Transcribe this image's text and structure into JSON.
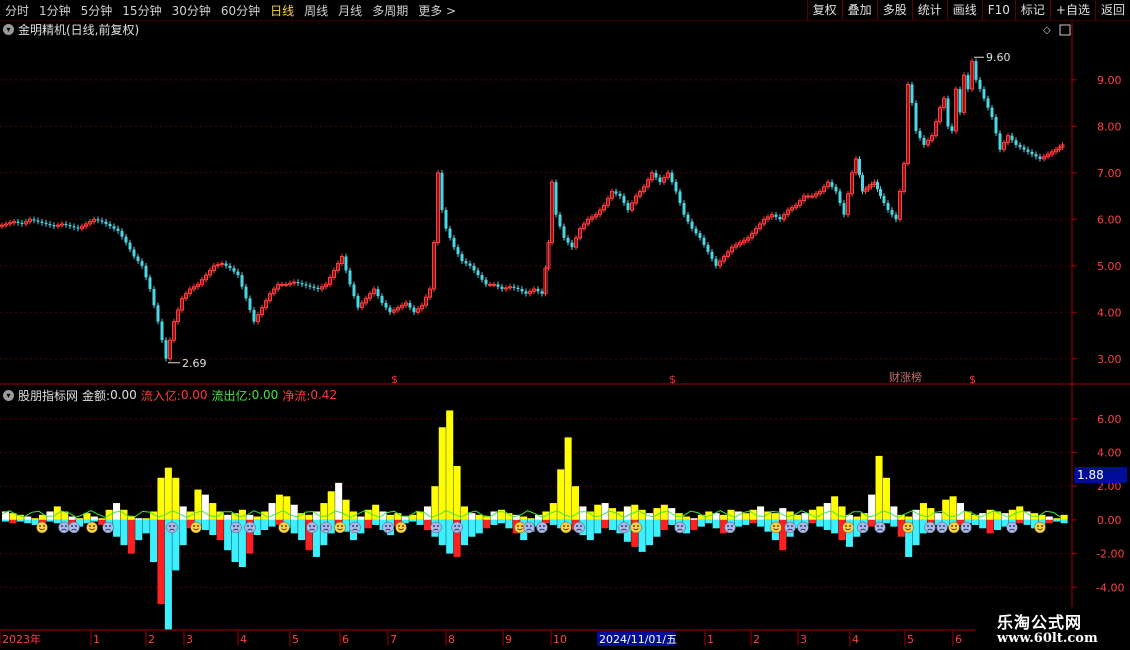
{
  "toolbar": {
    "periods": [
      "分时",
      "1分钟",
      "5分钟",
      "15分钟",
      "30分钟",
      "60分钟",
      "日线",
      "周线",
      "月线",
      "多周期",
      "更多 >"
    ],
    "active_period": "日线",
    "actions": [
      "复权",
      "叠加",
      "多股",
      "统计",
      "画线",
      "F10",
      "标记",
      "+自选",
      "返回"
    ]
  },
  "main_title": "金明精机(日线,前复权)",
  "indicator_header": {
    "name": "股朋指标网",
    "amount_label": "金额:",
    "amount_value": "0.00",
    "inflow_label": "流入亿:",
    "inflow_value": "0.00",
    "outflow_label": "流出亿:",
    "outflow_value": "0.00",
    "net_label": "净流:",
    "net_value": "0.42"
  },
  "markers": {
    "high_label": "9.60",
    "low_label": "2.69",
    "event_label": "财涨榜",
    "dollar": "$"
  },
  "current_value_badge": "1.88",
  "watermark": {
    "title": "乐淘公式网",
    "url": "www.60lt.com"
  },
  "time_axis": {
    "labels": [
      "2023年",
      "1",
      "2",
      "3",
      "4",
      "5",
      "6",
      "7",
      "8",
      "9",
      "10",
      "2024/11/01/五",
      "1",
      "2",
      "3",
      "4",
      "5",
      "6"
    ],
    "positions": [
      2,
      93,
      148,
      186,
      240,
      292,
      342,
      390,
      448,
      505,
      553,
      598,
      707,
      753,
      800,
      852,
      907,
      955
    ]
  },
  "colors": {
    "up": "#ff3b3b",
    "down": "#4ad7e6",
    "yellow": "#ffff00",
    "white": "#ffffff",
    "cyan": "#3cf0ff",
    "red": "#ff2020",
    "green": "#3fe83f",
    "grid": "#5a0000"
  },
  "chart_data": [
    {
      "type": "line",
      "title": "金明精机(日线,前复权)",
      "ylim": [
        2.5,
        9.9
      ],
      "yticks": [
        "3.00",
        "4.00",
        "5.00",
        "6.00",
        "7.00",
        "8.00",
        "9.00"
      ],
      "grid": true,
      "x": [
        0,
        8,
        16,
        24,
        32,
        40,
        48,
        56,
        64,
        72,
        80,
        88,
        96,
        104,
        112,
        120,
        128,
        136,
        144,
        152,
        160,
        168,
        176,
        184,
        192,
        200,
        208,
        216,
        224,
        232,
        240,
        248,
        256,
        264,
        272,
        280,
        288,
        296,
        304,
        312,
        320,
        328,
        336,
        344,
        352,
        360,
        368,
        376,
        384,
        392,
        400,
        408,
        416,
        424,
        432,
        436,
        440,
        444,
        448,
        456,
        464,
        472,
        480,
        488,
        496,
        504,
        512,
        520,
        528,
        536,
        544,
        550,
        554,
        558,
        566,
        574,
        582,
        590,
        598,
        606,
        614,
        622,
        630,
        638,
        646,
        654,
        662,
        670,
        678,
        686,
        694,
        702,
        710,
        718,
        726,
        734,
        742,
        750,
        758,
        766,
        774,
        782,
        790,
        798,
        806,
        814,
        822,
        830,
        838,
        846,
        854,
        858,
        864,
        870,
        876,
        882,
        890,
        898,
        906,
        910,
        914,
        918,
        926,
        934,
        942,
        946,
        950,
        954,
        958,
        962,
        966,
        970,
        974,
        978,
        986,
        994,
        1002,
        1010,
        1018,
        1026,
        1034,
        1042,
        1050,
        1058,
        1064
      ],
      "series": [
        {
          "name": "",
          "values": [
            5.85,
            5.9,
            5.95,
            5.9,
            6.0,
            5.95,
            5.9,
            5.85,
            5.9,
            5.85,
            5.8,
            5.9,
            6.0,
            5.95,
            5.85,
            5.75,
            5.5,
            5.2,
            5.0,
            4.5,
            3.8,
            3.0,
            3.8,
            4.3,
            4.5,
            4.6,
            4.8,
            5.0,
            5.05,
            4.95,
            4.8,
            4.3,
            3.8,
            4.1,
            4.4,
            4.6,
            4.6,
            4.65,
            4.6,
            4.55,
            4.5,
            4.6,
            4.9,
            5.2,
            4.6,
            4.1,
            4.3,
            4.5,
            4.2,
            4.0,
            4.1,
            4.2,
            4.0,
            4.15,
            4.5,
            5.5,
            7.0,
            6.2,
            5.8,
            5.4,
            5.1,
            5.0,
            4.8,
            4.6,
            4.6,
            4.5,
            4.55,
            4.5,
            4.4,
            4.5,
            4.4,
            5.5,
            6.8,
            6.1,
            5.6,
            5.4,
            5.8,
            6.0,
            6.1,
            6.3,
            6.6,
            6.5,
            6.2,
            6.5,
            6.7,
            7.0,
            6.8,
            7.0,
            6.6,
            6.1,
            5.8,
            5.6,
            5.3,
            5.0,
            5.2,
            5.4,
            5.5,
            5.6,
            5.8,
            6.0,
            6.1,
            6.0,
            6.2,
            6.3,
            6.5,
            6.5,
            6.6,
            6.8,
            6.6,
            6.1,
            7.0,
            7.3,
            6.6,
            6.7,
            6.8,
            6.5,
            6.2,
            6.0,
            7.2,
            8.9,
            8.5,
            7.9,
            7.6,
            7.8,
            8.4,
            8.6,
            8.0,
            7.9,
            8.8,
            8.3,
            9.1,
            8.8,
            9.4,
            9.0,
            8.6,
            8.2,
            7.5,
            7.8,
            7.6,
            7.5,
            7.4,
            7.3,
            7.4,
            7.5,
            7.6,
            7.8,
            7.9
          ]
        }
      ]
    },
    {
      "type": "bar",
      "title": "股朋指标网",
      "ylim": [
        -6.3,
        7.0
      ],
      "yticks": [
        "6.00",
        "4.00",
        "2.00",
        "0.00",
        "-2.00",
        "-4.00"
      ],
      "grid": true,
      "series": [
        {
          "name": "流入亿",
          "values": [
            0.5,
            0.4,
            0.3,
            0.2,
            0.1,
            0.3,
            0.5,
            0.8,
            0.5,
            0.2,
            0.1,
            0.4,
            0.2,
            0.1,
            0.6,
            1.0,
            0.6,
            0.2,
            0.1,
            0.1,
            0.5,
            2.5,
            3.1,
            2.5,
            0.8,
            0.5,
            1.8,
            1.5,
            1.0,
            0.5,
            0.3,
            0.4,
            0.6,
            0.3,
            0.2,
            0.5,
            1.0,
            1.5,
            1.4,
            0.9,
            0.4,
            0.3,
            0.5,
            1.0,
            1.7,
            2.2,
            1.2,
            0.5,
            0.2,
            0.6,
            0.9,
            0.5,
            0.3,
            0.4,
            0.2,
            0.3,
            0.5,
            0.8,
            2.0,
            5.5,
            6.5,
            3.2,
            0.8,
            0.4,
            0.3,
            0.2,
            0.5,
            0.6,
            0.4,
            0.3,
            0.2,
            0.1,
            0.3,
            0.5,
            1.0,
            3.0,
            4.9,
            2.0,
            0.8,
            0.5,
            0.9,
            1.0,
            0.7,
            0.5,
            0.8,
            0.9,
            0.6,
            0.4,
            0.7,
            0.9,
            0.7,
            0.4,
            0.2,
            0.1,
            0.3,
            0.5,
            0.4,
            0.3,
            0.6,
            0.5,
            0.4,
            0.6,
            0.8,
            0.5,
            0.4,
            0.7,
            0.5,
            0.3,
            0.4,
            0.6,
            0.8,
            1.0,
            1.4,
            0.8,
            0.3,
            0.2,
            0.4,
            1.5,
            3.8,
            2.5,
            0.8,
            0.3,
            0.2,
            0.6,
            1.0,
            0.7,
            0.4,
            1.2,
            1.4,
            1.0,
            0.5,
            0.3,
            0.4,
            0.6,
            0.5,
            0.4,
            0.6,
            0.8,
            0.5,
            0.4,
            0.3,
            0.2,
            0.1,
            0.3
          ]
        },
        {
          "name": "流出亿",
          "values": [
            0.1,
            0.2,
            0.1,
            0.2,
            0.3,
            0.2,
            0.1,
            0.2,
            0.3,
            0.5,
            0.4,
            0.2,
            0.1,
            0.3,
            0.4,
            1.0,
            1.5,
            2.0,
            1.2,
            0.8,
            2.5,
            5.0,
            6.5,
            3.0,
            1.5,
            0.5,
            0.3,
            0.6,
            0.9,
            1.2,
            1.8,
            2.5,
            2.8,
            2.0,
            0.9,
            0.6,
            0.4,
            0.3,
            0.5,
            0.8,
            1.2,
            1.8,
            2.2,
            1.5,
            0.8,
            0.5,
            0.7,
            1.2,
            0.8,
            0.5,
            0.3,
            0.6,
            0.9,
            0.4,
            0.2,
            0.1,
            0.3,
            0.6,
            1.0,
            1.5,
            2.0,
            2.2,
            1.5,
            1.0,
            0.8,
            0.5,
            0.3,
            0.2,
            0.5,
            0.8,
            1.2,
            0.7,
            0.4,
            0.2,
            0.3,
            0.5,
            0.3,
            0.6,
            0.9,
            1.2,
            0.8,
            0.5,
            0.6,
            0.8,
            1.3,
            1.6,
            1.9,
            1.5,
            1.0,
            0.6,
            0.3,
            0.5,
            0.8,
            0.6,
            0.4,
            0.2,
            0.5,
            0.8,
            0.6,
            0.4,
            0.3,
            0.2,
            0.4,
            0.7,
            1.2,
            1.8,
            1.0,
            0.5,
            0.3,
            0.2,
            0.4,
            0.6,
            0.8,
            1.2,
            1.6,
            1.0,
            0.6,
            0.4,
            0.3,
            0.2,
            0.4,
            1.0,
            2.2,
            1.5,
            0.8,
            0.5,
            0.3,
            0.4,
            0.5,
            0.3,
            0.2,
            0.3,
            0.5,
            0.8,
            0.6,
            0.4,
            0.3,
            0.2,
            0.3,
            0.5,
            0.4,
            0.2,
            0.1,
            0.2
          ]
        }
      ]
    }
  ]
}
